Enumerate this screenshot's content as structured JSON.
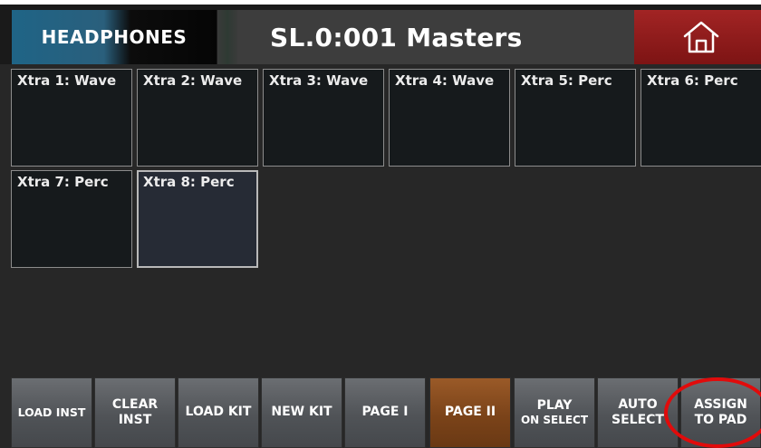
{
  "header": {
    "headphones_label": "HEADPHONES",
    "title": "SL.0:001 Masters",
    "home_icon": "home-icon"
  },
  "pads": [
    {
      "label": "Xtra 1: Wave"
    },
    {
      "label": "Xtra 2: Wave"
    },
    {
      "label": "Xtra 3: Wave"
    },
    {
      "label": "Xtra 4: Wave"
    },
    {
      "label": "Xtra 5: Perc"
    },
    {
      "label": "Xtra 6: Perc"
    },
    {
      "label": "Xtra 7: Perc"
    },
    {
      "label": "Xtra 8: Perc",
      "selected": true
    }
  ],
  "buttons": [
    {
      "line1": "LOAD INST",
      "line2": ""
    },
    {
      "line1": "CLEAR",
      "line2": "INST"
    },
    {
      "line1": "LOAD KIT",
      "line2": ""
    },
    {
      "line1": "NEW KIT",
      "line2": ""
    },
    {
      "line1": "PAGE I",
      "line2": ""
    },
    {
      "line1": "PAGE II",
      "line2": "",
      "active": true
    },
    {
      "line1": "PLAY",
      "line2": "ON SELECT"
    },
    {
      "line1": "AUTO",
      "line2": "SELECT"
    },
    {
      "line1": "ASSIGN",
      "line2": "TO PAD"
    }
  ],
  "colors": {
    "background": "#272727",
    "home_button": "#a22424",
    "active_button": "#9a5a28",
    "callout": "#e10b0b"
  }
}
